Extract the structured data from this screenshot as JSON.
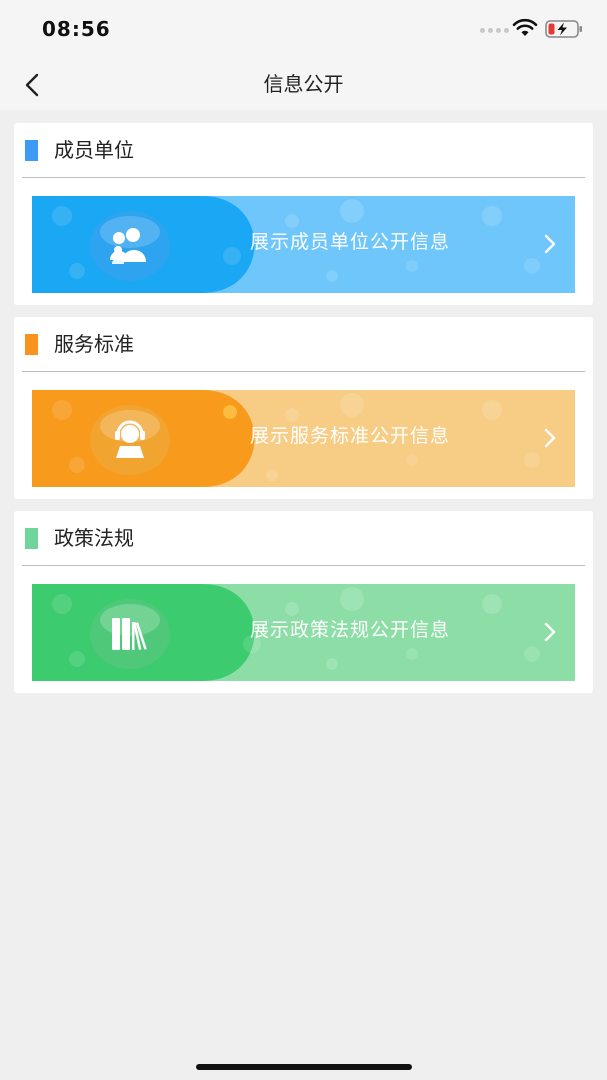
{
  "status": {
    "time": "08:56",
    "icons": [
      "signal-dots-icon",
      "wifi-icon",
      "battery-charging-icon"
    ],
    "battery_color": "#e53935"
  },
  "nav": {
    "title": "信息公开",
    "back_icon": "chevron-left-icon"
  },
  "sections": [
    {
      "title": "成员单位",
      "marker_color": "#3d9bf5",
      "banner_text": "展示成员单位公开信息",
      "icon": "users-group-icon",
      "colors": {
        "light": "#6ec6fb",
        "dark": "#1aa7f3",
        "icon_bg": "#2ea3ef"
      }
    },
    {
      "title": "服务标准",
      "marker_color": "#f7931e",
      "banner_text": "展示服务标准公开信息",
      "icon": "headset-agent-icon",
      "colors": {
        "light": "#f7cc84",
        "dark": "#f89a1c",
        "icon_bg": "#f2a431"
      }
    },
    {
      "title": "政策法规",
      "marker_color": "#6fd59a",
      "banner_text": "展示政策法规公开信息",
      "icon": "books-icon",
      "colors": {
        "light": "#8ddea6",
        "dark": "#3ccb6e",
        "icon_bg": "#4fc979"
      }
    }
  ]
}
